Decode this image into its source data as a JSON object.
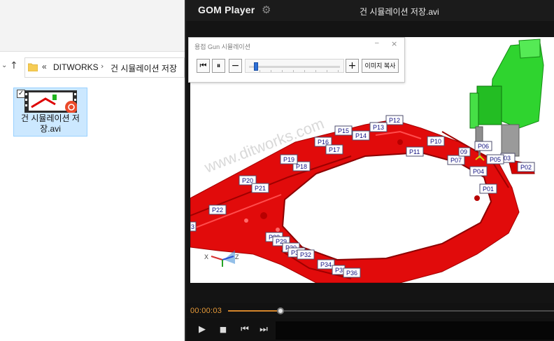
{
  "explorer": {
    "address": {
      "overflow_marker": "«",
      "segments": [
        "DITWORKS",
        "건 시뮬레이션 저장"
      ]
    },
    "file": {
      "name_line1": "건 시뮬레이션 저",
      "name_line2": "장.avi",
      "checked": "✓"
    }
  },
  "player": {
    "brand": "GOM Player",
    "title": "건 시뮬레이션 저장.avi",
    "time": "00:00:03",
    "progress": 0.16
  },
  "dialog": {
    "title": "용접 Gun 시뮬레이션",
    "copy_button": "이미지 복사",
    "slider_value": 0.08
  },
  "scene": {
    "watermark": "www.ditworks.com",
    "point_labels": {
      "p01": "P01",
      "p02": "P02",
      "p03": "03",
      "p04": "P04",
      "p05": "P05",
      "p06": "P06",
      "p07": "P07",
      "p09": "09",
      "p10": "P10",
      "p11": "P11",
      "p12": "P12",
      "p13": "P13",
      "p14": "P14",
      "p15": "P15",
      "p16": "P16",
      "p17": "P17",
      "p18": "P18",
      "p19": "P19",
      "p20": "P20",
      "p21": "P21",
      "p22": "P22",
      "p28": "P28",
      "p29": "P29",
      "p30": "P30",
      "p32": "P32",
      "p34": "P34",
      "p35": "P3",
      "p36": "P36",
      "p31": "P31",
      "edge": "3"
    },
    "axes": {
      "x": "X",
      "z": "Z"
    }
  },
  "colors": {
    "frame_red": "#e00000",
    "gun_green": "#2fd42f",
    "accent_orange": "#e79a38"
  }
}
